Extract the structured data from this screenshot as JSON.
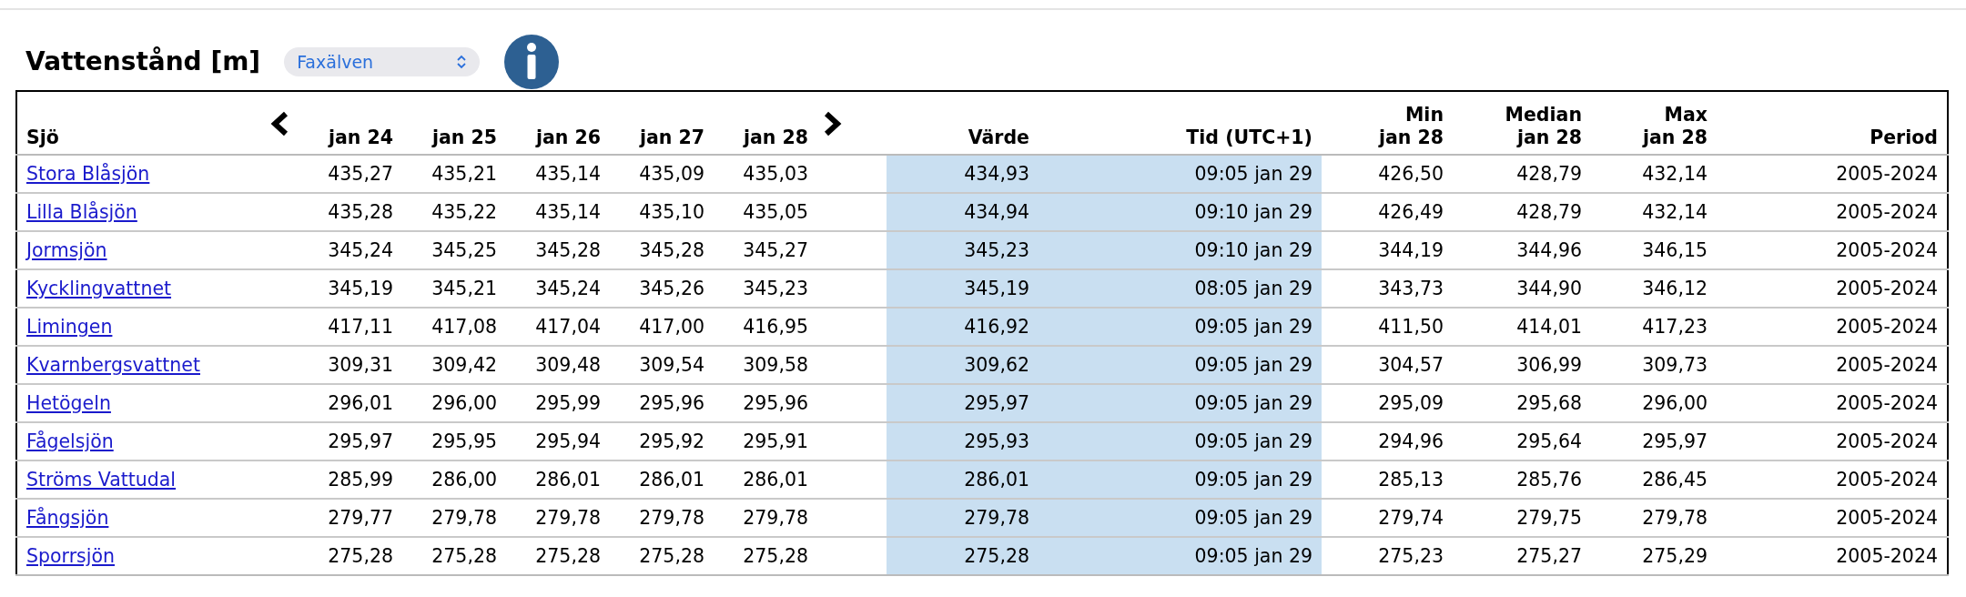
{
  "title": "Vattenstånd [m]",
  "river_select": {
    "value": "Faxälven"
  },
  "table": {
    "columns": {
      "lake": "Sjö",
      "days": [
        "jan 24",
        "jan 25",
        "jan 26",
        "jan 27",
        "jan 28"
      ],
      "value": "Värde",
      "time": "Tid (UTC+1)",
      "min": [
        "Min",
        "jan 28"
      ],
      "median": [
        "Median",
        "jan 28"
      ],
      "max": [
        "Max",
        "jan 28"
      ],
      "period": "Period"
    },
    "rows": [
      {
        "lake": "Stora Blåsjön",
        "days": [
          "435,27",
          "435,21",
          "435,14",
          "435,09",
          "435,03"
        ],
        "value": "434,93",
        "time": "09:05 jan 29",
        "min": "426,50",
        "median": "428,79",
        "max": "432,14",
        "period": "2005-2024"
      },
      {
        "lake": "Lilla Blåsjön",
        "days": [
          "435,28",
          "435,22",
          "435,14",
          "435,10",
          "435,05"
        ],
        "value": "434,94",
        "time": "09:10 jan 29",
        "min": "426,49",
        "median": "428,79",
        "max": "432,14",
        "period": "2005-2024"
      },
      {
        "lake": "Jormsjön",
        "days": [
          "345,24",
          "345,25",
          "345,28",
          "345,28",
          "345,27"
        ],
        "value": "345,23",
        "time": "09:10 jan 29",
        "min": "344,19",
        "median": "344,96",
        "max": "346,15",
        "period": "2005-2024"
      },
      {
        "lake": "Kycklingvattnet",
        "days": [
          "345,19",
          "345,21",
          "345,24",
          "345,26",
          "345,23"
        ],
        "value": "345,19",
        "time": "08:05 jan 29",
        "min": "343,73",
        "median": "344,90",
        "max": "346,12",
        "period": "2005-2024"
      },
      {
        "lake": "Limingen",
        "days": [
          "417,11",
          "417,08",
          "417,04",
          "417,00",
          "416,95"
        ],
        "value": "416,92",
        "time": "09:05 jan 29",
        "min": "411,50",
        "median": "414,01",
        "max": "417,23",
        "period": "2005-2024"
      },
      {
        "lake": "Kvarnbergsvattnet",
        "days": [
          "309,31",
          "309,42",
          "309,48",
          "309,54",
          "309,58"
        ],
        "value": "309,62",
        "time": "09:05 jan 29",
        "min": "304,57",
        "median": "306,99",
        "max": "309,73",
        "period": "2005-2024"
      },
      {
        "lake": "Hetögeln",
        "days": [
          "296,01",
          "296,00",
          "295,99",
          "295,96",
          "295,96"
        ],
        "value": "295,97",
        "time": "09:05 jan 29",
        "min": "295,09",
        "median": "295,68",
        "max": "296,00",
        "period": "2005-2024"
      },
      {
        "lake": "Fågelsjön",
        "days": [
          "295,97",
          "295,95",
          "295,94",
          "295,92",
          "295,91"
        ],
        "value": "295,93",
        "time": "09:05 jan 29",
        "min": "294,96",
        "median": "295,64",
        "max": "295,97",
        "period": "2005-2024"
      },
      {
        "lake": "Ströms Vattudal",
        "days": [
          "285,99",
          "286,00",
          "286,01",
          "286,01",
          "286,01"
        ],
        "value": "286,01",
        "time": "09:05 jan 29",
        "min": "285,13",
        "median": "285,76",
        "max": "286,45",
        "period": "2005-2024"
      },
      {
        "lake": "Fångsjön",
        "days": [
          "279,77",
          "279,78",
          "279,78",
          "279,78",
          "279,78"
        ],
        "value": "279,78",
        "time": "09:05 jan 29",
        "min": "279,74",
        "median": "279,75",
        "max": "279,78",
        "period": "2005-2024"
      },
      {
        "lake": "Sporrsjön",
        "days": [
          "275,28",
          "275,28",
          "275,28",
          "275,28",
          "275,28"
        ],
        "value": "275,28",
        "time": "09:05 jan 29",
        "min": "275,23",
        "median": "275,27",
        "max": "275,29",
        "period": "2005-2024"
      }
    ]
  }
}
